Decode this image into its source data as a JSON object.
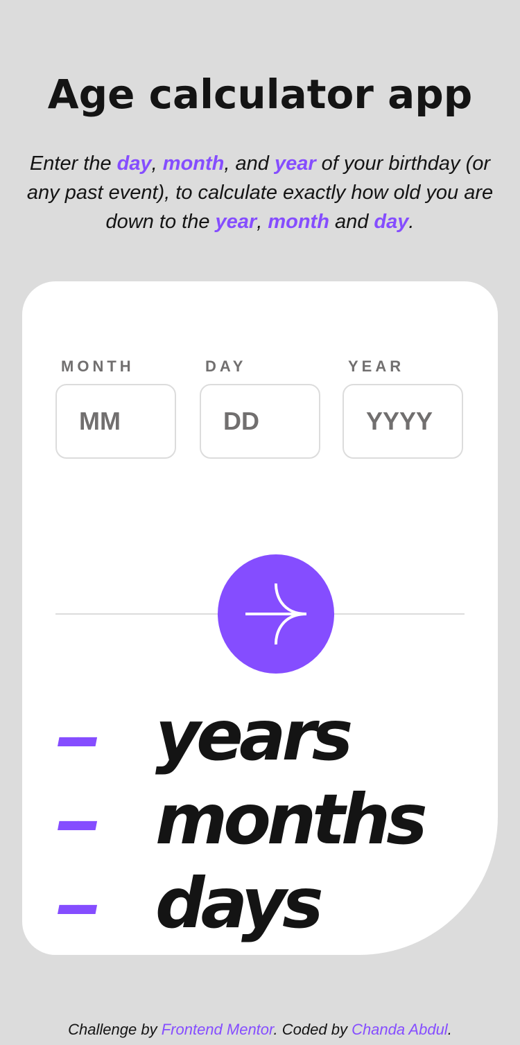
{
  "header": {
    "title": "Age calculator app",
    "intro": {
      "part1": "Enter the ",
      "hl_day": "day",
      "part2": ", ",
      "hl_month": "month",
      "part3": ", and ",
      "hl_year": "year",
      "part4": " of your birthday (or any past event), to calculate exactly how old you are down to the ",
      "hl_year2": "year",
      "part5": ", ",
      "hl_month2": "month",
      "part6": " and ",
      "hl_day2": "day",
      "part7": "."
    }
  },
  "form": {
    "month": {
      "label": "MONTH",
      "placeholder": "MM",
      "value": ""
    },
    "day": {
      "label": "DAY",
      "placeholder": "DD",
      "value": ""
    },
    "year": {
      "label": "YEAR",
      "placeholder": "YYYY",
      "value": ""
    },
    "submit_icon": "arrow-right-icon"
  },
  "results": {
    "years": {
      "value": "--",
      "unit": "years"
    },
    "months": {
      "value": "--",
      "unit": "months"
    },
    "days": {
      "value": "--",
      "unit": "days"
    }
  },
  "footer": {
    "prefix": "Challenge by ",
    "link1": "Frontend Mentor",
    "middle": ". Coded by ",
    "link2": "Chanda Abdul",
    "suffix": "."
  },
  "colors": {
    "accent": "#854dff",
    "background": "#dcdcdc",
    "card": "#ffffff",
    "text": "#141414",
    "label": "#716f6f"
  }
}
